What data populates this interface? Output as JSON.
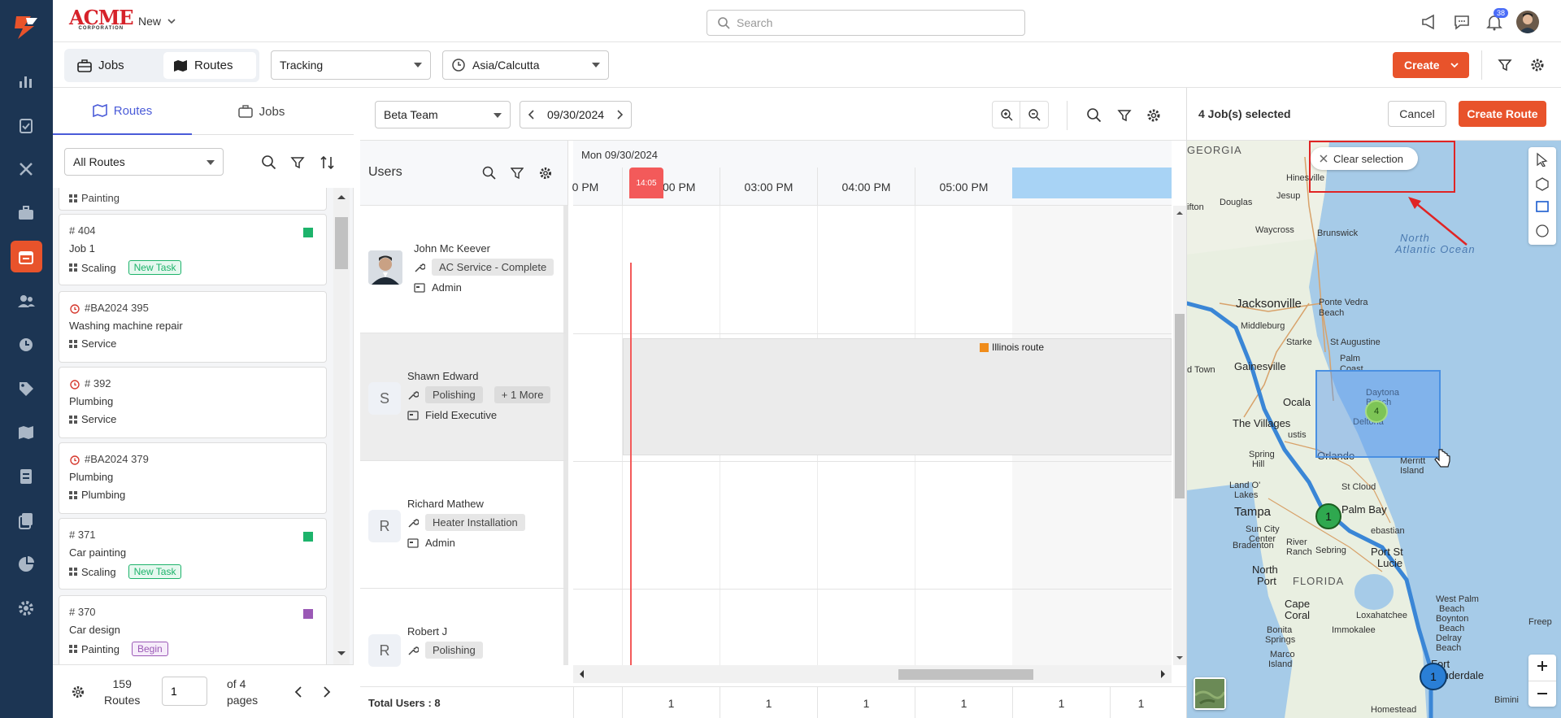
{
  "topbar": {
    "brand": "ACME",
    "brand_sub": "CORPORATION",
    "new_label": "New",
    "search_placeholder": "Search",
    "notif_count": "38"
  },
  "toolbar": {
    "seg_jobs": "Jobs",
    "seg_routes": "Routes",
    "tracking": "Tracking",
    "timezone": "Asia/Calcutta",
    "create_label": "Create"
  },
  "left": {
    "tab_routes": "Routes",
    "tab_jobs": "Jobs",
    "filter_value": "All Routes",
    "cards": [
      {
        "l3": "Painting"
      },
      {
        "l1": "# 404",
        "l2": "Job 1",
        "l3": "Scaling",
        "badge": "New Task",
        "color": "#1db36b"
      },
      {
        "l1": "#BA2024 395",
        "l2": "Washing machine repair",
        "l3": "Service"
      },
      {
        "l1": "# 392",
        "l2": "Plumbing",
        "l3": "Service"
      },
      {
        "l1": "#BA2024 379",
        "l2": "Plumbing",
        "l3": "Plumbing"
      },
      {
        "l1": "# 371",
        "l2": "Car painting",
        "l3": "Scaling",
        "badge": "New Task",
        "color": "#1db36b"
      },
      {
        "l1": "# 370",
        "l2": "Car design",
        "l3": "Painting",
        "badge": "Begin",
        "color": "#9b59b6"
      }
    ],
    "footer_count": "159",
    "footer_label": "Routes",
    "page_value": "1",
    "of_pages_1": "of 4",
    "of_pages_2": "pages"
  },
  "center": {
    "team": "Beta Team",
    "date": "09/30/2024",
    "date_header": "Mon 09/30/2024",
    "users_title": "Users",
    "now_label": "14:05",
    "times": [
      "0 PM",
      "02:00 PM",
      "03:00 PM",
      "04:00 PM",
      "05:00 PM"
    ],
    "route_label": "Illinois route",
    "users": [
      {
        "name": "John Mc Keever",
        "skill": "AC Service - Complete",
        "role": "Admin"
      },
      {
        "name": "Shawn Edward",
        "initial": "S",
        "skill": "Polishing",
        "more": "+ 1 More",
        "role": "Field Executive"
      },
      {
        "name": "Richard Mathew",
        "initial": "R",
        "skill": "Heater Installation",
        "role": "Admin"
      },
      {
        "name": "Robert J",
        "initial": "R",
        "skill": "Polishing"
      }
    ],
    "total_users": "Total Users : 8",
    "bottom_values": [
      "1",
      "1",
      "1",
      "1",
      "1",
      "1"
    ]
  },
  "map": {
    "selected": "4 Job(s) selected",
    "cancel": "Cancel",
    "create_route": "Create Route",
    "clear_selection": "Clear selection",
    "ocean1": "North",
    "ocean2": "Atlantic Ocean",
    "cluster_4": "4",
    "cluster_1a": "1",
    "cluster_1b": "1",
    "cities": {
      "georgia": "GEORGIA",
      "hinesville": "Hinesville",
      "douglas": "Douglas",
      "jesup": "Jesup",
      "waycross": "Waycross",
      "brunswick": "Brunswick",
      "ifton": "ifton",
      "jacksonville": "Jacksonville",
      "ponte": "Ponte Vedra",
      "ponte2": "Beach",
      "middleburg": "Middleburg",
      "starke": "Starke",
      "staug": "St Augustine",
      "gainesville": "Gainesville",
      "palm": "Palm",
      "palm2": "Coast",
      "dtown": "d Town",
      "ocala": "Ocala",
      "daytona": "Daytona",
      "daytona2": "Beach",
      "deltona": "Deltona",
      "villages": "The Villages",
      "ustis": "ustis",
      "spring": "Spring",
      "hill": "Hill",
      "orlando": "Orlando",
      "merritt": "Merritt",
      "island": "Island",
      "landolakes": "Land O'",
      "lakes": "Lakes",
      "stcloud": "St Cloud",
      "tampa": "Tampa",
      "suncity": "Sun City",
      "center": "Center",
      "palmbay": "Palm Bay",
      "sebastian": "ebastian",
      "river": "River",
      "ranch": "Ranch",
      "bradenton": "Bradenton",
      "sebring": "Sebring",
      "portst": "Port St",
      "lucie": "Lucie",
      "north": "North",
      "port": "Port",
      "florida": "FLORIDA",
      "wpalm": "West Palm",
      "wpalm2": "Beach",
      "boynton": "Boynton",
      "boynton2": "Beach",
      "delray": "Delray",
      "delray2": "Beach",
      "cape": "Cape",
      "coral": "Coral",
      "loxa": "Loxahatchee",
      "bonita": "Bonita",
      "springs": "Springs",
      "immokalee": "Immokalee",
      "fort": "Fort",
      "lauderdale": "Lauderdale",
      "marco": "Marco",
      "island2": "Island",
      "homestead": "Homestead",
      "bimini": "Bimini",
      "freep": "Freep"
    }
  }
}
